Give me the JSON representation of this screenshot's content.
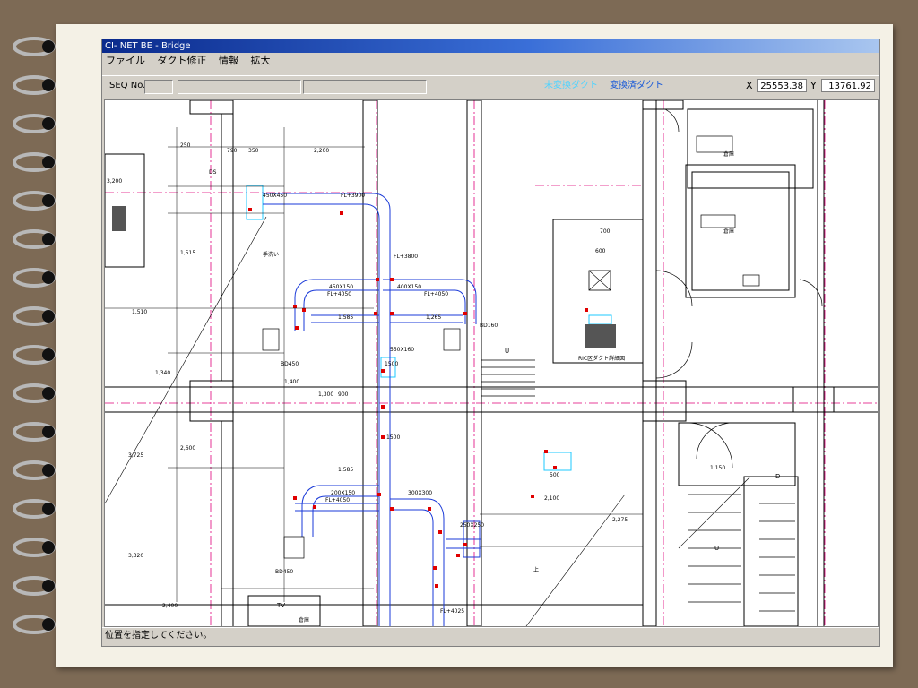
{
  "window": {
    "title": "CI- NET BE - Bridge",
    "menu": [
      "ファイル",
      "ダクト修正",
      "情報",
      "拡大"
    ],
    "seq_label": "SEQ No.",
    "legend_unconverted": "未変換ダクト",
    "legend_converted": "変換済ダクト",
    "coord_x_label": "X",
    "coord_x_value": "25553.38",
    "coord_y_label": "Y",
    "coord_y_value": "13761.92",
    "status_text": "位置を指定してください。"
  },
  "drawing": {
    "labels": {
      "fl3900": "FL+3900",
      "fl3800": "FL+3800",
      "fl4050a": "FL+4050",
      "fl4050b": "FL+4050",
      "fl4050c": "FL+4050",
      "fl4025": "FL+4025",
      "bd450": "BD450",
      "bd450b": "BD450",
      "bd160": "BD160",
      "dim_1585a": "1,585",
      "dim_1585b": "1,585",
      "dim_1265": "1,265",
      "dim_1515": "1,515",
      "dim_1510": "1,510",
      "dim_2200": "2,200",
      "dim_2275": "2,275",
      "dim_600": "600",
      "dim_700": "700",
      "dim_250": "250",
      "dim_350": "350",
      "dim_790": "790",
      "dim_1340": "1,340",
      "dim_3200": "3,200",
      "dim_2400": "2,400",
      "dim_3725": "3,725",
      "dim_3320": "3,320",
      "dim_2600": "2,600",
      "dim_1300": "1,300",
      "dim_900": "900",
      "dim_1400": "1,400",
      "dim_500": "500",
      "dim_2100": "2,100",
      "dim_1150": "1,150",
      "dim_450x150": "450X150",
      "dim_400x150": "400X150",
      "dim_450x450": "450X450",
      "dim_550x160": "550X160",
      "dim_250x250": "250X250",
      "dim_300x300": "300X300",
      "dim_200x150": "200X150",
      "dim_1500": "1500",
      "dim_1500b": "1500",
      "tb_label": "TV",
      "room_a": "倉庫",
      "room_b": "倉庫",
      "room_c": "倉庫",
      "detail_note": "RIC区ダクト詳細図",
      "fixture_note": "手洗い",
      "u_mark": "U",
      "u_mark_b": "U",
      "d_mark": "D",
      "ds_mark": "DS",
      "stair_up": "上"
    }
  }
}
